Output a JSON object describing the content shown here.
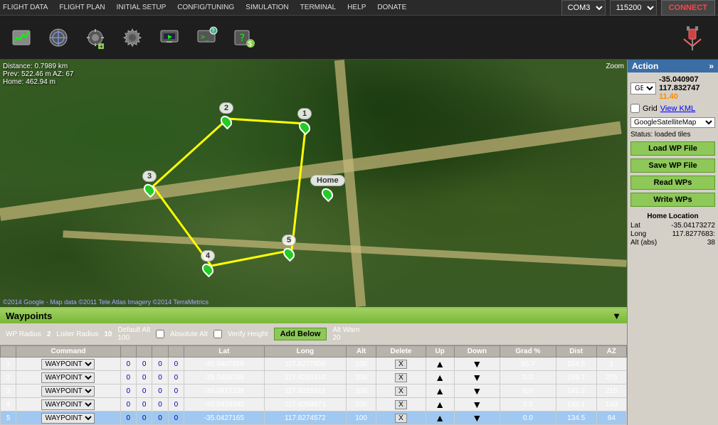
{
  "nav": {
    "items": [
      "FLIGHT DATA",
      "FLIGHT PLAN",
      "INITIAL SETUP",
      "CONFIG/TUNING",
      "SIMULATION",
      "TERMINAL",
      "HELP",
      "DONATE"
    ]
  },
  "connection": {
    "port": "COM3",
    "baud": "115200",
    "btn": "CONNECT"
  },
  "map_info": {
    "distance": "Distance: 0.7989 km",
    "prev": "Prev: 522.46 m AZ: 67",
    "home": "Home: 462.94 m"
  },
  "map_zoom": "Zoom",
  "google_credit": "©2014 Google - Map data ©2011 Tele Atlas  Imagery ©2014 TerraMetrics",
  "action": {
    "title": "Action",
    "coord_type": "GEO",
    "lat": "-35.040907",
    "lon": "117.832747",
    "alt": "11.40",
    "grid_label": "Grid",
    "kml": "View KML",
    "map_type": "GoogleSatelliteMap",
    "status": "Status: loaded tiles",
    "load_wp": "Load WP File",
    "save_wp": "Save WP File",
    "read_wp": "Read WPs",
    "write_wp": "Write WPs",
    "home_location": "Home Location",
    "lat_label": "Lat",
    "lat_val": "-35.04173272",
    "lon_label": "Long",
    "lon_val": "117.8277683:",
    "alt_label": "Alt (abs)",
    "alt_val": "38"
  },
  "waypoints": {
    "title": "Waypoints",
    "toolbar": {
      "wp_radius_label": "WP Radius",
      "wp_radius_val": "2",
      "loiter_radius_label": "Loiter Radius",
      "loiter_radius_val": "10",
      "default_alt_label": "Default Alt",
      "default_alt_val": "100",
      "absolute_alt_label": "Absolute Alt",
      "verify_height_label": "Verify Height",
      "add_below_label": "Add Below",
      "alt_warn_label": "Alt Warn",
      "alt_warn_val": "20"
    },
    "columns": [
      "",
      "Command",
      "",
      "",
      "",
      "",
      "Lat",
      "Long",
      "Alt",
      "Delete",
      "Up",
      "Down",
      "Grad %",
      "Dist",
      "AZ"
    ],
    "rows": [
      {
        "id": 1,
        "cmd": "WAYPOINT",
        "v1": "0",
        "v2": "0",
        "v3": "0",
        "v4": "0",
        "lat": "-35.0407928",
        "lon": "117.8277898",
        "alt": "100",
        "del": "X",
        "grad": "95.7",
        "dist": "104.5",
        "az": "1",
        "selected": false
      },
      {
        "id": 2,
        "cmd": "WAYPOINT",
        "v1": "0",
        "v2": "0",
        "v3": "0",
        "v4": "0",
        "lat": "-35.0406786",
        "lon": "117.8260410",
        "alt": "100",
        "del": "X",
        "grad": "0.0",
        "dist": "159.7",
        "az": "275",
        "selected": false
      },
      {
        "id": 3,
        "cmd": "WAYPOINT",
        "v1": "0",
        "v2": "0",
        "v3": "0",
        "v4": "0",
        "lat": "-35.0417239",
        "lon": "117.8251612",
        "alt": "100",
        "del": "X",
        "grad": "0.0",
        "dist": "141.2",
        "az": "215",
        "selected": false
      },
      {
        "id": 4,
        "cmd": "WAYPOINT",
        "v1": "0",
        "v2": "0",
        "v3": "0",
        "v4": "0",
        "lat": "-35.0428395",
        "lon": "117.8259873",
        "alt": "100",
        "del": "X",
        "grad": "0.0",
        "dist": "145.1",
        "az": "149",
        "selected": false
      },
      {
        "id": 5,
        "cmd": "WAYPOINT",
        "v1": "0",
        "v2": "0",
        "v3": "0",
        "v4": "0",
        "lat": "-35.0427165",
        "lon": "117.8274572",
        "alt": "100",
        "del": "X",
        "grad": "0.0",
        "dist": "134.5",
        "az": "84",
        "selected": true
      }
    ]
  }
}
